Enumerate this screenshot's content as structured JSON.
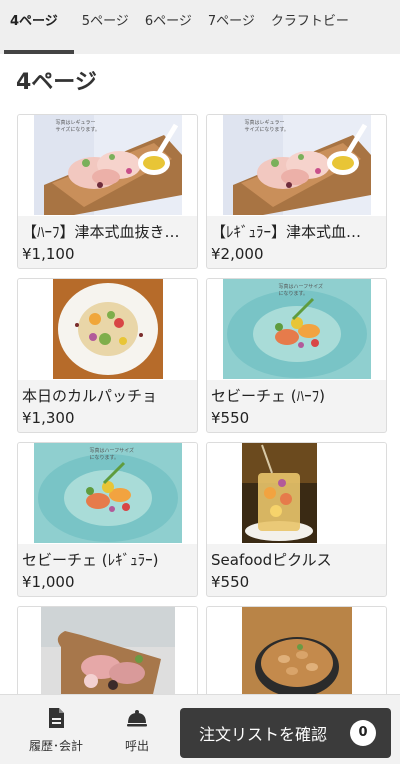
{
  "tabs": [
    {
      "label": "4ページ",
      "active": true
    },
    {
      "label": "5ページ",
      "active": false
    },
    {
      "label": "6ページ",
      "active": false
    },
    {
      "label": "7ページ",
      "active": false
    },
    {
      "label": "クラフトビー",
      "active": false
    }
  ],
  "section": {
    "title": "4ページ"
  },
  "items": [
    {
      "name": "【ﾊｰﾌ】津本式血抜き…",
      "price": "¥1,100",
      "image_note": "写真はレギュラー\nサイズになります。"
    },
    {
      "name": "【ﾚｷﾞｭﾗｰ】津本式血…",
      "price": "¥2,000",
      "image_note": "写真はレギュラー\nサイズになります。"
    },
    {
      "name": "本日のカルパッチョ",
      "price": "¥1,300"
    },
    {
      "name": "セビーチェ (ﾊｰﾌ)",
      "price": "¥550",
      "image_note": "写真はハーフサイズ\nになります。"
    },
    {
      "name": "セビーチェ (ﾚｷﾞｭﾗｰ)",
      "price": "¥1,000",
      "image_note": "写真はハーフサイズ\nになります。"
    },
    {
      "name": "Seafoodピクルス",
      "price": "¥550"
    },
    {
      "name": "",
      "price": ""
    },
    {
      "name": "",
      "price": ""
    }
  ],
  "bottom_bar": {
    "history_label": "履歴･会計",
    "history_icon": "document-icon",
    "call_label": "呼出",
    "call_icon": "bell-icon",
    "confirm_label": "注文リストを確認",
    "order_count": "0"
  },
  "colors": {
    "tab_bg": "#efefef",
    "button_bg": "#3b3b3b",
    "card_bg": "#f3f3f3"
  }
}
